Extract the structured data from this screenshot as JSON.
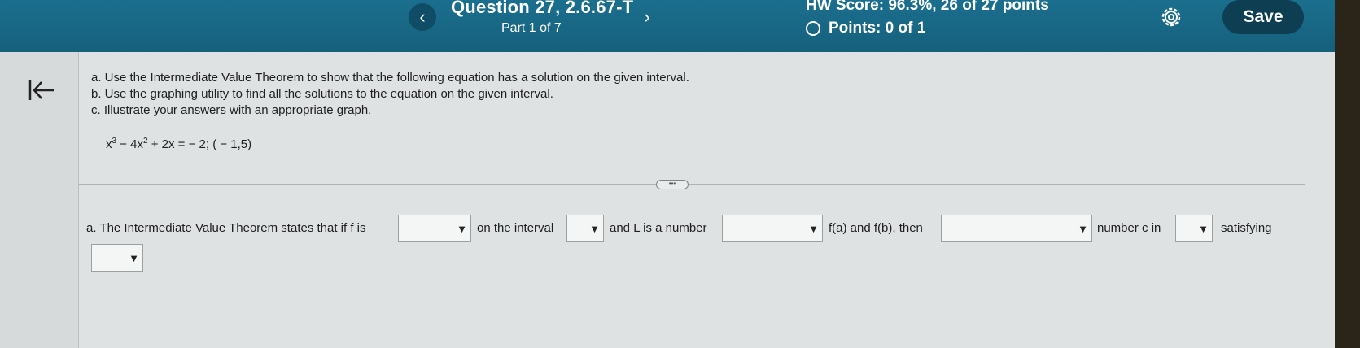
{
  "header": {
    "question_title": "Question 27, 2.6.67-T",
    "part": "Part 1 of 7",
    "hw_score": "HW Score: 96.3%, 26 of 27 points",
    "points": "Points: 0 of 1",
    "save_label": "Save",
    "prev_icon": "‹",
    "next_icon": "›",
    "accent_color": "#1b6f8e"
  },
  "problem": {
    "instructions": [
      "a. Use the Intermediate Value Theorem to show that the following equation has a solution on the given interval.",
      "b. Use the graphing utility to find all the solutions to the equation on the given interval.",
      "c. Illustrate your answers with an appropriate graph."
    ],
    "equation": {
      "t1": "x",
      "e1": "3",
      "t2": " − 4x",
      "e2": "2",
      "t3": " + 2x = − 2; ( − 1,5)"
    }
  },
  "answer": {
    "prefix": "a. The Intermediate Value Theorem states that if f is",
    "text_on_interval": "on the interval",
    "text_and_L": "and L is a number",
    "text_fab": "f(a) and f(b), then",
    "text_number_c": "number c in",
    "text_satisfying": "satisfying",
    "dropdowns": [
      {
        "selected": ""
      },
      {
        "selected": ""
      },
      {
        "selected": ""
      },
      {
        "selected": ""
      },
      {
        "selected": ""
      },
      {
        "selected": ""
      }
    ],
    "dropdown_arrow": "▼"
  }
}
